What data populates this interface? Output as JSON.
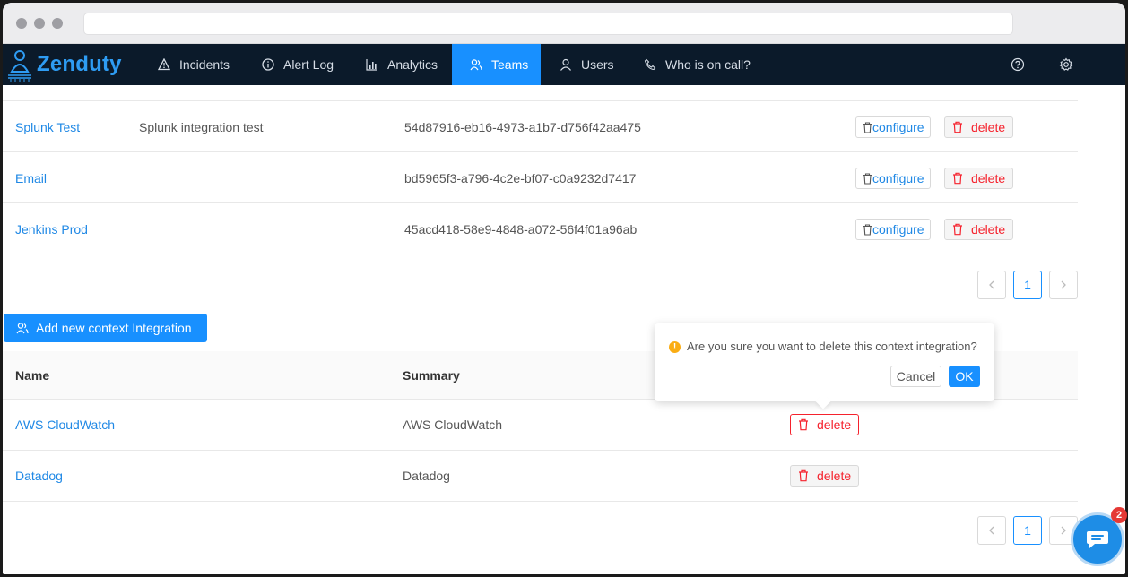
{
  "nav": {
    "brand": "Zenduty",
    "items": [
      {
        "label": "Incidents",
        "icon": "warning-icon"
      },
      {
        "label": "Alert Log",
        "icon": "info-icon"
      },
      {
        "label": "Analytics",
        "icon": "bar-chart-icon"
      },
      {
        "label": "Teams",
        "icon": "team-icon",
        "active": true
      },
      {
        "label": "Users",
        "icon": "user-icon"
      },
      {
        "label": "Who is on call?",
        "icon": "phone-icon"
      }
    ],
    "right_icons": [
      "help-icon",
      "settings-icon"
    ]
  },
  "integrations": {
    "rows": [
      {
        "name": "Splunk Test",
        "summary": "Splunk integration test",
        "key": "54d87916-eb16-4973-a1b7-d756f42aa475",
        "configure": "configure",
        "delete": "delete"
      },
      {
        "name": "Email",
        "summary": "",
        "key": "bd5965f3-a796-4c2e-bf07-c0a9232d7417",
        "configure": "configure",
        "delete": "delete"
      },
      {
        "name": "Jenkins Prod",
        "summary": "",
        "key": "45acd418-58e9-4848-a072-56f4f01a96ab",
        "configure": "configure",
        "delete": "delete"
      }
    ],
    "page": "1"
  },
  "context": {
    "add_button": "Add new context Integration",
    "headers": {
      "name": "Name",
      "summary": "Summary"
    },
    "rows": [
      {
        "name": "AWS CloudWatch",
        "summary": "AWS CloudWatch",
        "delete": "delete"
      },
      {
        "name": "Datadog",
        "summary": "Datadog",
        "delete": "delete"
      }
    ],
    "page": "1"
  },
  "popconfirm": {
    "message": "Are you sure you want to delete this context integration?",
    "cancel": "Cancel",
    "ok": "OK"
  },
  "chat": {
    "badge": "2"
  },
  "colors": {
    "primary": "#1890ff",
    "nav_bg": "#0b1a2a",
    "danger": "#f5222d",
    "warning": "#faad14"
  }
}
